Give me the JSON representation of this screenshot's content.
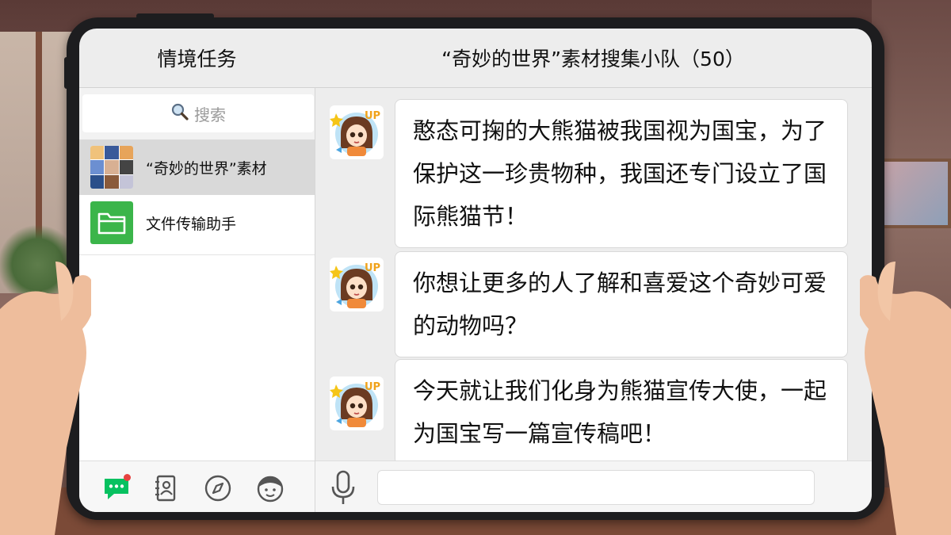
{
  "header": {
    "left_title": "情境任务",
    "chat_title": "“奇妙的世界”素材搜集小队（50）"
  },
  "sidebar": {
    "search_placeholder": "搜索",
    "conversations": [
      {
        "name": "“奇妙的世界”素材",
        "active": true
      },
      {
        "name": "文件传输助手",
        "active": false
      }
    ],
    "tabs": [
      {
        "icon": "chat-icon",
        "has_badge": true
      },
      {
        "icon": "contacts-icon",
        "has_badge": false
      },
      {
        "icon": "compass-icon",
        "has_badge": false
      },
      {
        "icon": "profile-face-icon",
        "has_badge": false
      }
    ]
  },
  "messages": [
    {
      "text": "憨态可掬的大熊猫被我国视为国宝，为了保护这一珍贵物种，我国还专门设立了国际熊猫节！"
    },
    {
      "text": "你想让更多的人了解和喜爱这个奇妙可爱的动物吗？"
    },
    {
      "text": "今天就让我们化身为熊猫宣传大使，一起为国宝写一篇宣传稿吧！"
    }
  ],
  "avatar_badge": "UP",
  "colors": {
    "accent_green": "#07c160",
    "folder_green": "#3bb54a",
    "badge_red": "#e64340",
    "bubble_bg": "#ffffff",
    "chat_bg": "#ededed"
  },
  "input": {
    "mic_icon": "microphone-icon",
    "value": ""
  }
}
